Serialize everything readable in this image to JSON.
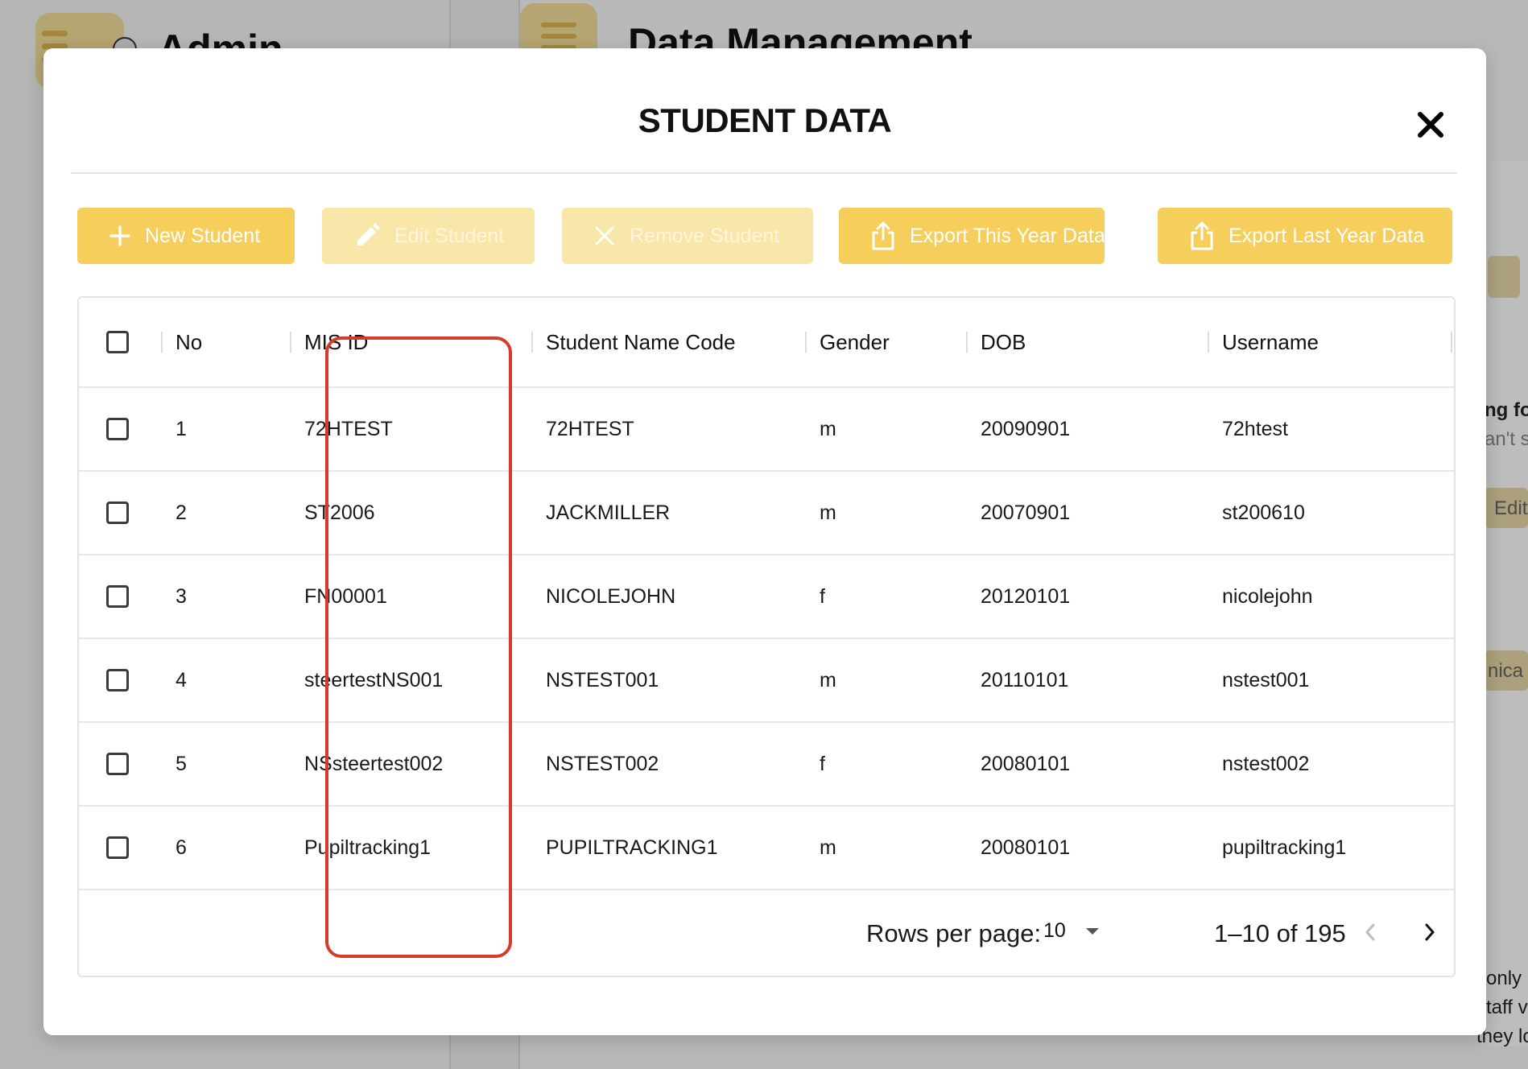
{
  "background": {
    "left_title": "Admin",
    "main_title": "Data Management",
    "fragments": [
      "ng fo",
      "an't s",
      "Edit",
      "nica",
      "only",
      "taff v",
      "they lo"
    ]
  },
  "modal": {
    "title": "STUDENT DATA",
    "close_icon": "close-icon"
  },
  "toolbar": {
    "new_student": "New Student",
    "edit_student": "Edit Student",
    "remove_student": "Remove Student",
    "export_this_year": "Export This Year Data",
    "export_last_year": "Export Last Year Data",
    "accent_color": "#f5ce5b",
    "disabled_color": "#f9e6a9"
  },
  "table": {
    "headers": {
      "no": "No",
      "mis_id": "MIS ID",
      "student_name_code": "Student Name Code",
      "gender": "Gender",
      "dob": "DOB",
      "username": "Username"
    },
    "rows": [
      {
        "no": "1",
        "mis_id": "72HTEST",
        "name_code": "72HTEST",
        "gender": "m",
        "dob": "20090901",
        "username": "72htest"
      },
      {
        "no": "2",
        "mis_id": "ST2006",
        "name_code": "JACKMILLER",
        "gender": "m",
        "dob": "20070901",
        "username": "st200610"
      },
      {
        "no": "3",
        "mis_id": "FN00001",
        "name_code": "NICOLEJOHN",
        "gender": "f",
        "dob": "20120101",
        "username": "nicolejohn"
      },
      {
        "no": "4",
        "mis_id": "steertestNS001",
        "name_code": "NSTEST001",
        "gender": "m",
        "dob": "20110101",
        "username": "nstest001"
      },
      {
        "no": "5",
        "mis_id": "NSsteertest002",
        "name_code": "NSTEST002",
        "gender": "f",
        "dob": "20080101",
        "username": "nstest002"
      },
      {
        "no": "6",
        "mis_id": "Pupiltracking1",
        "name_code": "PUPILTRACKING1",
        "gender": "m",
        "dob": "20080101",
        "username": "pupiltracking1"
      }
    ]
  },
  "pagination": {
    "rows_per_page_label": "Rows per page:",
    "rows_per_page_value": "10",
    "range": "1–10 of 195"
  },
  "annotation": {
    "highlight_color": "#d63a2a"
  }
}
